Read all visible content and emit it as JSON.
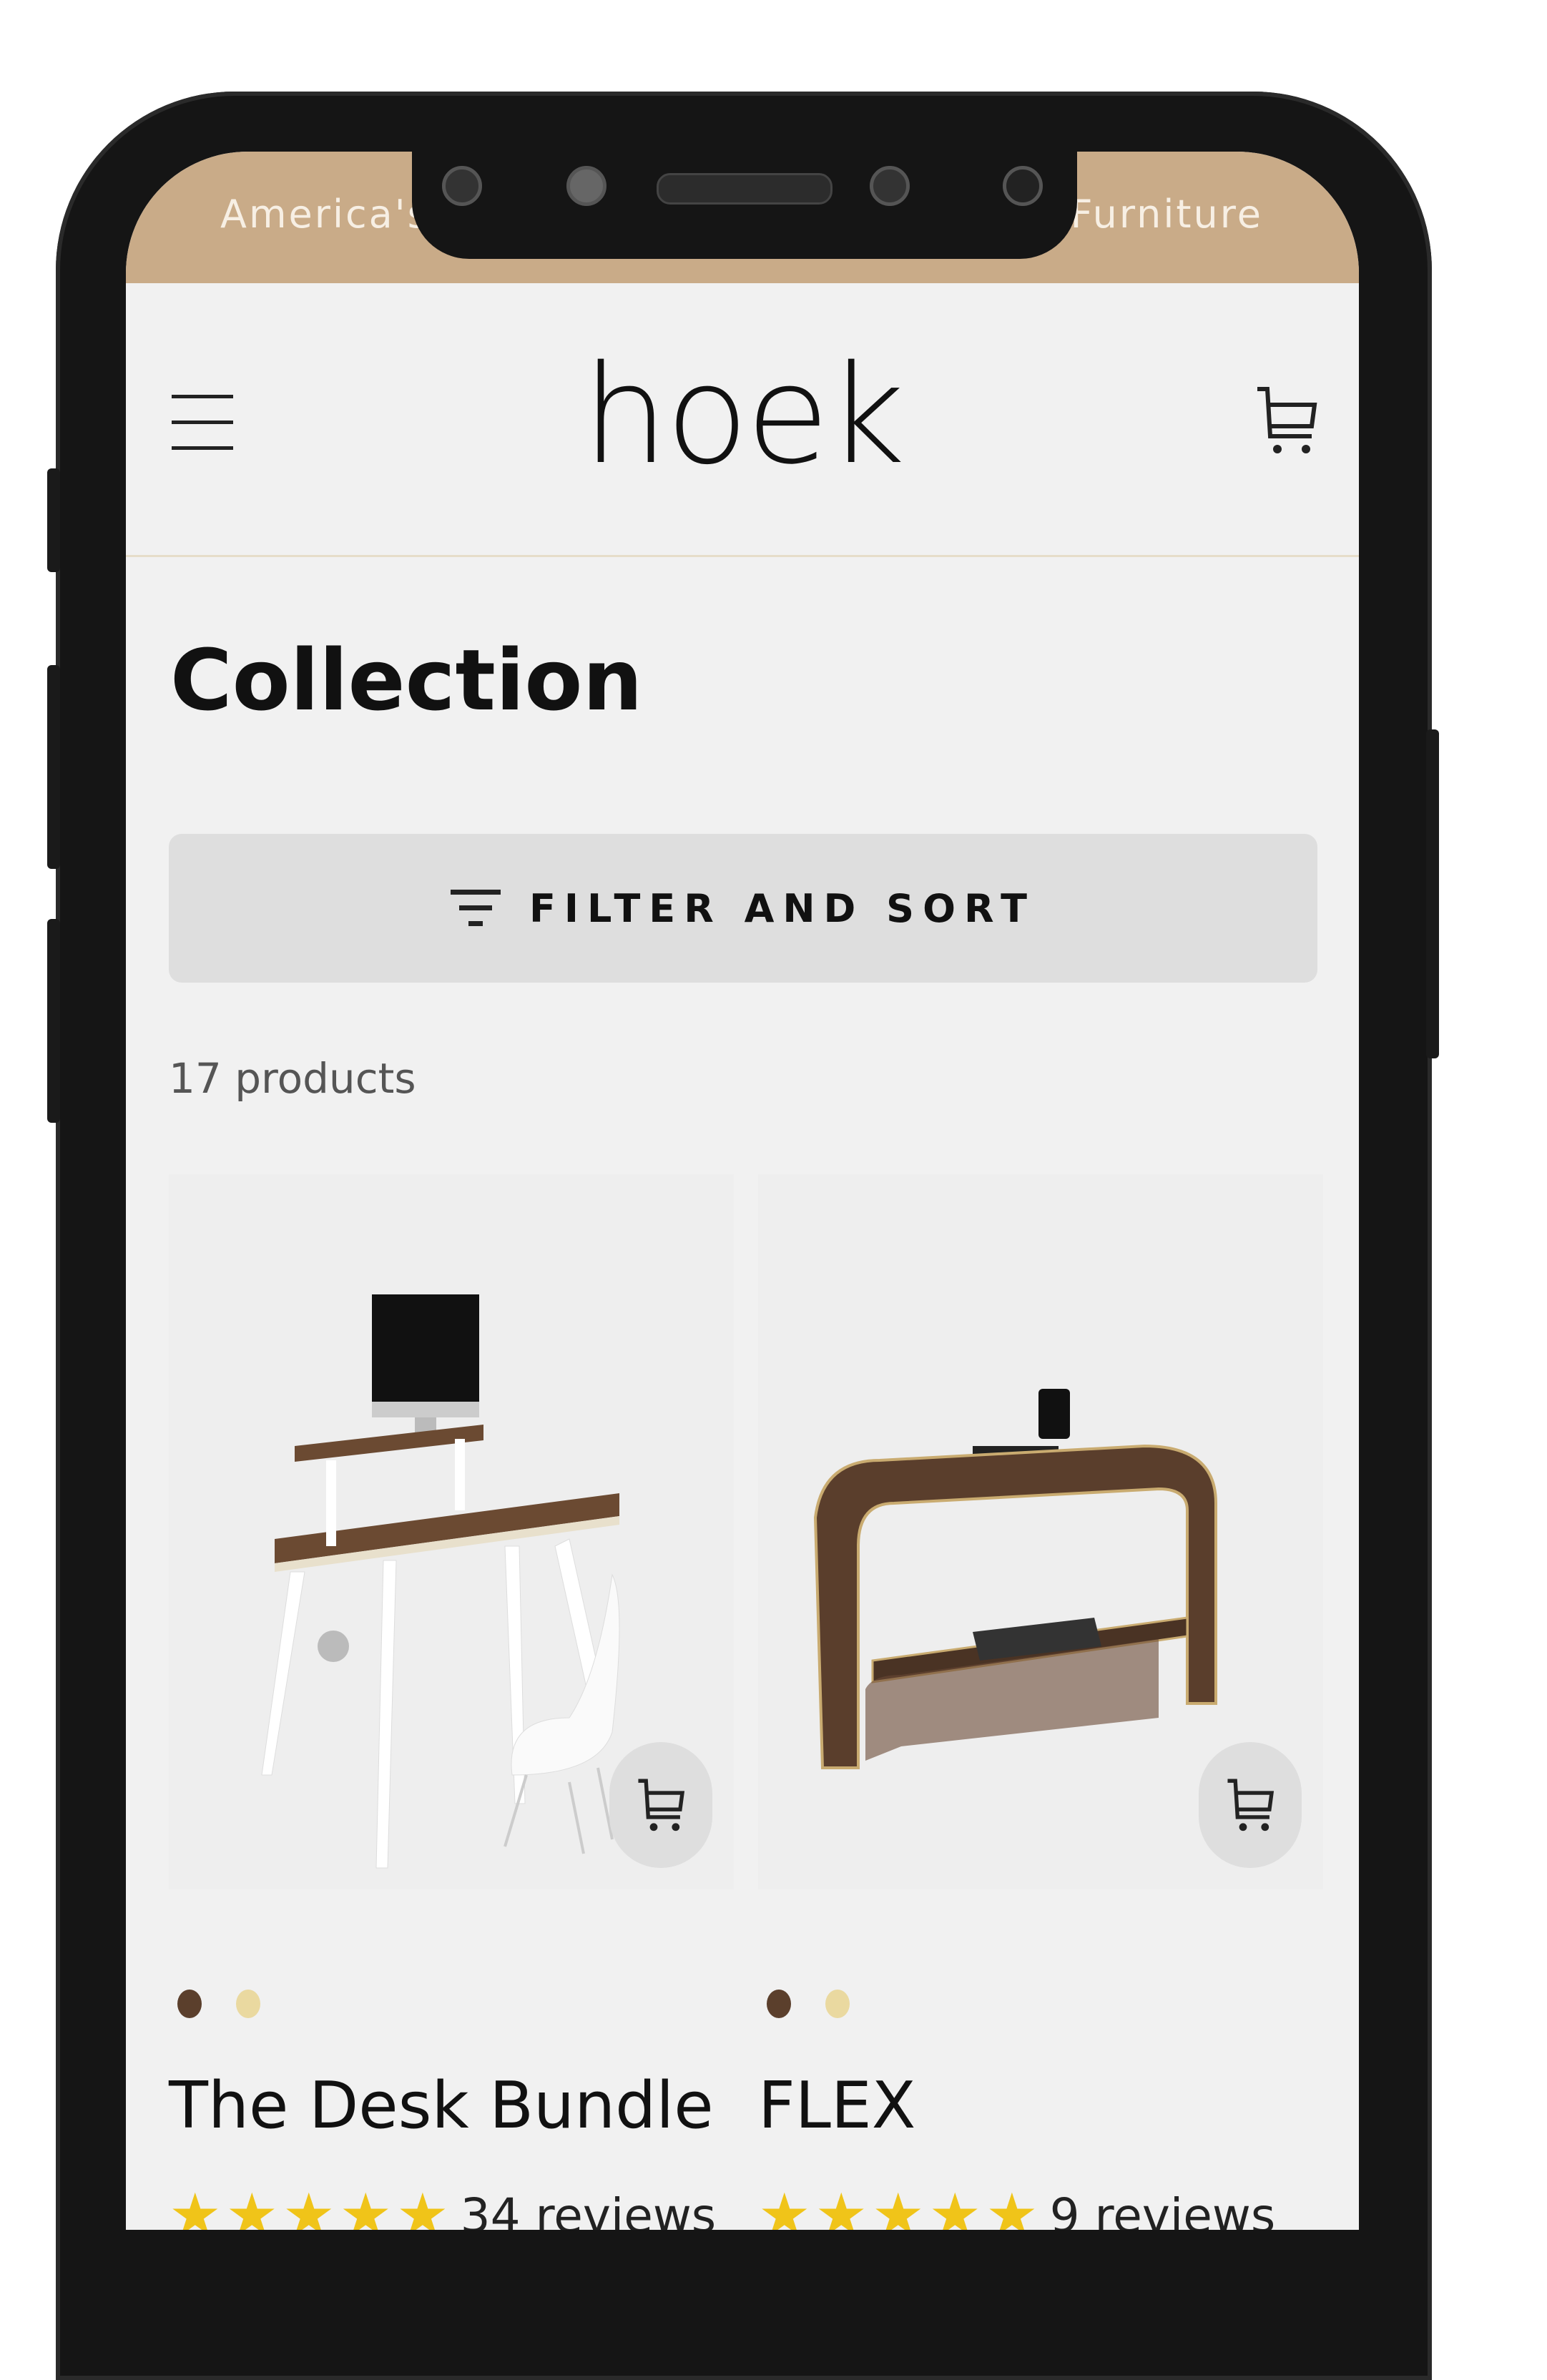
{
  "banner": {
    "left_text": "America's",
    "right_text": "Furniture"
  },
  "header": {
    "logo": "hoek",
    "menu_icon": "hamburger-icon",
    "cart_icon": "cart-icon"
  },
  "page": {
    "title": "Collection",
    "filter_label": "FILTER AND SORT",
    "product_count": "17 products"
  },
  "colors": {
    "banner": "#c9ab88",
    "star": "#f0c419",
    "swatch_walnut": "#5b3f2c",
    "swatch_maple": "#ead9a0"
  },
  "products": [
    {
      "name": "The Desk Bundle",
      "rating": 5,
      "reviews": "34 reviews",
      "swatches": [
        "#5b3f2c",
        "#ead9a0"
      ]
    },
    {
      "name": "FLEX",
      "rating": 5,
      "reviews": "9 reviews",
      "swatches": [
        "#5b3f2c",
        "#ead9a0"
      ]
    }
  ]
}
